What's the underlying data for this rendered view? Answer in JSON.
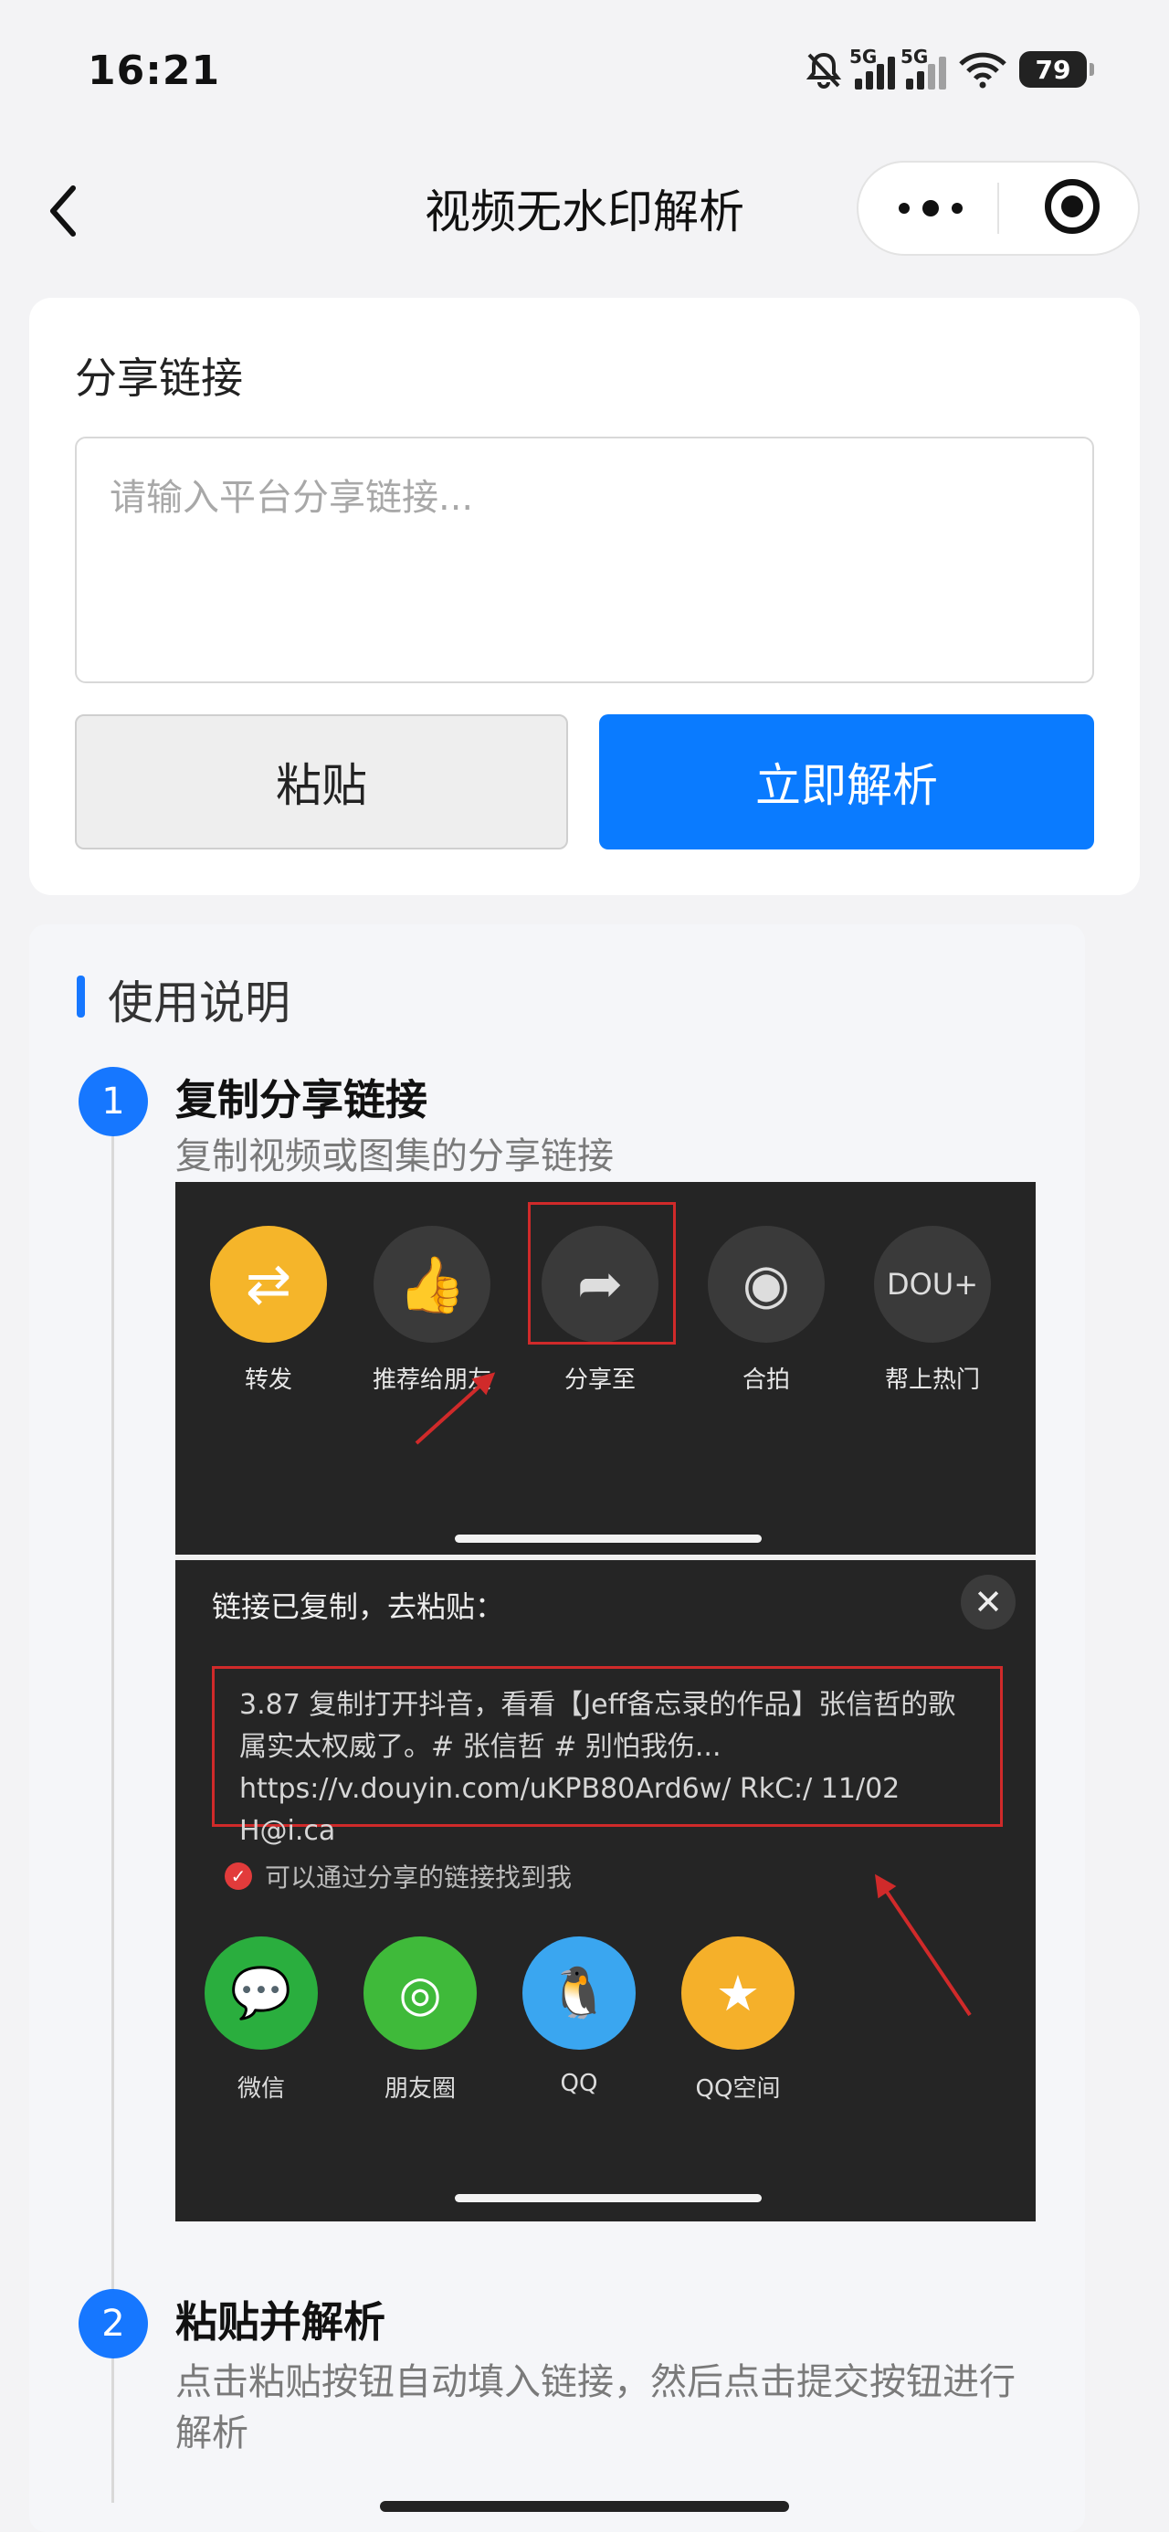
{
  "status": {
    "time": "16:21",
    "signal1": "5G",
    "signal2": "5G",
    "battery": "79"
  },
  "nav": {
    "title": "视频无水印解析"
  },
  "share": {
    "label": "分享链接",
    "placeholder": "请输入平台分享链接...",
    "value": "",
    "paste_label": "粘贴",
    "parse_label": "立即解析"
  },
  "colors": {
    "primary": "#0a7bff",
    "accent_bar": "#1677ff",
    "highlight_red": "#d02a2a"
  },
  "instructions": {
    "title": "使用说明",
    "steps": [
      {
        "number": "1",
        "title": "复制分享链接",
        "desc": "复制视频或图集的分享链接"
      },
      {
        "number": "2",
        "title": "粘贴并解析",
        "desc": "点击粘贴按钮自动填入链接，然后点击提交按钮进行解析"
      }
    ]
  },
  "demo": {
    "share_items": [
      {
        "label": "转发",
        "icon": "repost-icon"
      },
      {
        "label": "推荐给朋友",
        "icon": "thumbs-up-icon"
      },
      {
        "label": "分享至",
        "icon": "share-arrow-icon"
      },
      {
        "label": "合拍",
        "icon": "duet-icon"
      },
      {
        "label": "帮上热门",
        "icon": "dou-plus-icon"
      }
    ],
    "copied_title": "链接已复制，去粘贴：",
    "copied_text": "3.87 复制打开抖音，看看【Jeff备忘录的作品】张信哲的歌属实太权威了。# 张信哲 # 别怕我伤... https://v.douyin.com/uKPB80Ard6w/ RkC:/ 11/02 H@i.ca",
    "find_text": "可以通过分享的链接找到我",
    "apps": [
      {
        "label": "微信",
        "icon": "wechat-icon",
        "color": "#2aae3e"
      },
      {
        "label": "朋友圈",
        "icon": "moments-icon",
        "color": "#3fba3a"
      },
      {
        "label": "QQ",
        "icon": "qq-icon",
        "color": "#3aa6f0"
      },
      {
        "label": "QQ空间",
        "icon": "qzone-icon",
        "color": "#f5b02a"
      }
    ]
  }
}
